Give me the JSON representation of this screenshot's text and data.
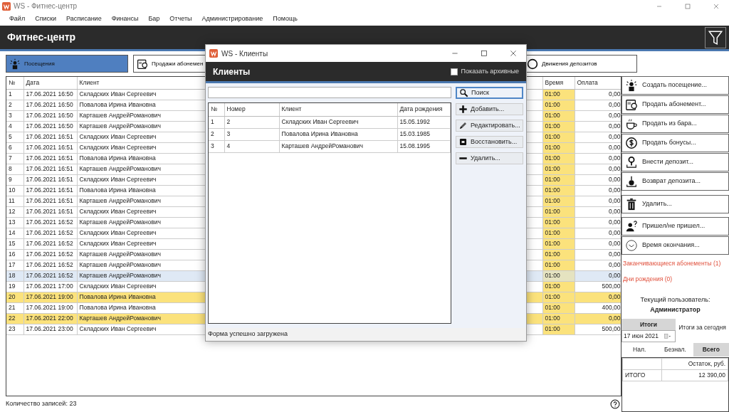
{
  "window": {
    "title": "WS - Фитнес-центр"
  },
  "menu": [
    "Файл",
    "Списки",
    "Расписание",
    "Финансы",
    "Бар",
    "Отчеты",
    "Администрирование",
    "Помощь"
  ],
  "header": {
    "title": "Фитнес-центр"
  },
  "tabs": [
    {
      "label": "Посещения",
      "kind": "visit",
      "selected": true
    },
    {
      "label": "Продажи абонемен",
      "kind": "subscription",
      "selected": false
    },
    {
      "label": "Движения депозитов",
      "kind": "deposit",
      "selected": false
    }
  ],
  "visits": {
    "columns": [
      "№",
      "Дата",
      "Клиент",
      "Время",
      "Оплата"
    ],
    "rows": [
      {
        "n": "1",
        "date": "17.06.2021 16:50",
        "client": "Складских Иван Сергеевич",
        "time": "01:00",
        "payment": "0,00",
        "selected": false,
        "highlighted": false
      },
      {
        "n": "2",
        "date": "17.06.2021 16:50",
        "client": "Повалова Ирина Ивановна",
        "time": "01:00",
        "payment": "0,00",
        "selected": false,
        "highlighted": false
      },
      {
        "n": "3",
        "date": "17.06.2021 16:50",
        "client": "Карташев АндрейРоманович",
        "time": "01:00",
        "payment": "0,00",
        "selected": false,
        "highlighted": false
      },
      {
        "n": "4",
        "date": "17.06.2021 16:50",
        "client": "Карташев АндрейРоманович",
        "time": "01:00",
        "payment": "0,00",
        "selected": false,
        "highlighted": false
      },
      {
        "n": "5",
        "date": "17.06.2021 16:51",
        "client": "Складских Иван Сергеевич",
        "time": "01:00",
        "payment": "0,00",
        "selected": false,
        "highlighted": false
      },
      {
        "n": "6",
        "date": "17.06.2021 16:51",
        "client": "Складских Иван Сергеевич",
        "time": "01:00",
        "payment": "0,00",
        "selected": false,
        "highlighted": false
      },
      {
        "n": "7",
        "date": "17.06.2021 16:51",
        "client": "Повалова Ирина Ивановна",
        "time": "01:00",
        "payment": "0,00",
        "selected": false,
        "highlighted": false
      },
      {
        "n": "8",
        "date": "17.06.2021 16:51",
        "client": "Карташев АндрейРоманович",
        "time": "01:00",
        "payment": "0,00",
        "selected": false,
        "highlighted": false
      },
      {
        "n": "9",
        "date": "17.06.2021 16:51",
        "client": "Складских Иван Сергеевич",
        "time": "01:00",
        "payment": "0,00",
        "selected": false,
        "highlighted": false
      },
      {
        "n": "10",
        "date": "17.06.2021 16:51",
        "client": "Повалова Ирина Ивановна",
        "time": "01:00",
        "payment": "0,00",
        "selected": false,
        "highlighted": false
      },
      {
        "n": "11",
        "date": "17.06.2021 16:51",
        "client": "Карташев АндрейРоманович",
        "time": "01:00",
        "payment": "0,00",
        "selected": false,
        "highlighted": false
      },
      {
        "n": "12",
        "date": "17.06.2021 16:51",
        "client": "Складских Иван Сергеевич",
        "time": "01:00",
        "payment": "0,00",
        "selected": false,
        "highlighted": false
      },
      {
        "n": "13",
        "date": "17.06.2021 16:52",
        "client": "Карташев АндрейРоманович",
        "time": "01:00",
        "payment": "0,00",
        "selected": false,
        "highlighted": false
      },
      {
        "n": "14",
        "date": "17.06.2021 16:52",
        "client": "Складских Иван Сергеевич",
        "time": "01:00",
        "payment": "0,00",
        "selected": false,
        "highlighted": false
      },
      {
        "n": "15",
        "date": "17.06.2021 16:52",
        "client": "Складских Иван Сергеевич",
        "time": "01:00",
        "payment": "0,00",
        "selected": false,
        "highlighted": false
      },
      {
        "n": "16",
        "date": "17.06.2021 16:52",
        "client": "Карташев АндрейРоманович",
        "time": "01:00",
        "payment": "0,00",
        "selected": false,
        "highlighted": false
      },
      {
        "n": "17",
        "date": "17.06.2021 16:52",
        "client": "Карташев АндрейРоманович",
        "time": "01:00",
        "payment": "0,00",
        "selected": false,
        "highlighted": false
      },
      {
        "n": "18",
        "date": "17.06.2021 16:52",
        "client": "Карташев АндрейРоманович",
        "time": "01:00",
        "payment": "0,00",
        "selected": true,
        "highlighted": false
      },
      {
        "n": "19",
        "date": "17.06.2021 17:00",
        "client": "Складских Иван Сергеевич",
        "time": "01:00",
        "payment": "500,00",
        "selected": false,
        "highlighted": false
      },
      {
        "n": "20",
        "date": "17.06.2021 19:00",
        "client": "Повалова Ирина Ивановна",
        "time": "01:00",
        "payment": "0,00",
        "selected": false,
        "highlighted": true
      },
      {
        "n": "21",
        "date": "17.06.2021 19:00",
        "client": "Повалова Ирина Ивановна",
        "time": "01:00",
        "payment": "400,00",
        "selected": false,
        "highlighted": false
      },
      {
        "n": "22",
        "date": "17.06.2021 22:00",
        "client": "Карташев АндрейРоманович",
        "time": "01:00",
        "payment": "0,00",
        "selected": false,
        "highlighted": true
      },
      {
        "n": "23",
        "date": "17.06.2021 23:00",
        "client": "Складских Иван Сергеевич",
        "time": "01:00",
        "payment": "500,00",
        "selected": false,
        "highlighted": false
      }
    ],
    "count_label": "Количество записей: 23"
  },
  "actions": [
    {
      "label": "Создать посещение...",
      "kind": "visit"
    },
    {
      "label": "Продать абонемент...",
      "kind": "subscription"
    },
    {
      "label": "Продать из бара...",
      "kind": "bar"
    },
    {
      "label": "Продать бонусы...",
      "kind": "bonus"
    },
    {
      "label": "Внести депозит...",
      "kind": "deposit_in"
    },
    {
      "label": "Возврат депозита...",
      "kind": "deposit_out"
    },
    {
      "label": "Удалить...",
      "kind": "delete"
    },
    {
      "label": "Пришел/не пришел...",
      "kind": "attendance"
    },
    {
      "label": "Время окончания...",
      "kind": "end_time"
    }
  ],
  "alerts": [
    "Заканчивающиеся абонементы (1)",
    "Дни рождения (0)"
  ],
  "user": {
    "caption": "Текущий пользователь:",
    "name": "Администратор"
  },
  "totals": {
    "tabs": [
      {
        "label": "Итоги",
        "selected": true
      },
      {
        "label": "Итоги за сегодня",
        "selected": false
      }
    ],
    "date": "17 июн 2021",
    "subtabs": [
      {
        "label": "Нал.",
        "selected": false
      },
      {
        "label": "Безнал.",
        "selected": false
      },
      {
        "label": "Всего",
        "selected": true
      }
    ],
    "column": "Остаток, руб.",
    "rows": [
      {
        "label": "ИТОГО",
        "value": "12 390,00"
      }
    ]
  },
  "dialog": {
    "title": "WS - Клиенты",
    "header": "Клиенты",
    "show_archived": {
      "label": "Показать архивные",
      "checked": false
    },
    "buttons": [
      {
        "label": "Поиск",
        "kind": "search",
        "focused": true
      },
      {
        "label": "Добавить...",
        "kind": "add",
        "focused": false
      },
      {
        "label": "Редактировать...",
        "kind": "edit",
        "focused": false
      },
      {
        "label": "Восстановить...",
        "kind": "restore",
        "focused": false
      },
      {
        "label": "Удалить...",
        "kind": "delete",
        "focused": false
      }
    ],
    "columns": [
      "№",
      "Номер",
      "Клиент",
      "Дата рождения"
    ],
    "rows": [
      {
        "n": "1",
        "number": "2",
        "client": "Складских Иван Сергеевич",
        "birth": "15.05.1992"
      },
      {
        "n": "2",
        "number": "3",
        "client": "Повалова Ирина Ивановна",
        "birth": "15.03.1985"
      },
      {
        "n": "3",
        "number": "4",
        "client": "Карташев АндрейРоманович",
        "birth": "15.08.1995"
      }
    ],
    "status": "Форма успешно загружена"
  }
}
